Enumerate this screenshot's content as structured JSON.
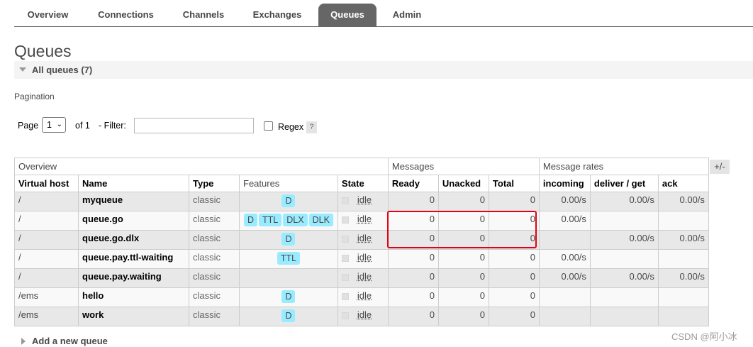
{
  "nav": {
    "tabs": [
      {
        "label": "Overview",
        "active": false
      },
      {
        "label": "Connections",
        "active": false
      },
      {
        "label": "Channels",
        "active": false
      },
      {
        "label": "Exchanges",
        "active": false
      },
      {
        "label": "Queues",
        "active": true
      },
      {
        "label": "Admin",
        "active": false
      }
    ]
  },
  "page": {
    "title": "Queues",
    "section_label": "All queues (7)"
  },
  "pagination": {
    "label": "Pagination",
    "page_label": "Page",
    "page_value": "1",
    "of_label": "of 1",
    "filter_label": "- Filter:",
    "filter_value": "",
    "regex_label": "Regex",
    "regex_checked": false,
    "help_label": "?"
  },
  "table": {
    "groups": {
      "overview": "Overview",
      "messages": "Messages",
      "rates": "Message rates"
    },
    "toggle_label": "+/-",
    "columns": {
      "vhost": "Virtual host",
      "name": "Name",
      "type": "Type",
      "features": "Features",
      "state": "State",
      "ready": "Ready",
      "unacked": "Unacked",
      "total": "Total",
      "incoming": "incoming",
      "deliver_get": "deliver / get",
      "ack": "ack"
    },
    "rows": [
      {
        "vhost": "/",
        "name": "myqueue",
        "type": "classic",
        "features": [
          "D"
        ],
        "state": "idle",
        "ready": "0",
        "unacked": "0",
        "total": "0",
        "incoming": "0.00/s",
        "deliver_get": "0.00/s",
        "ack": "0.00/s"
      },
      {
        "vhost": "/",
        "name": "queue.go",
        "type": "classic",
        "features": [
          "D",
          "TTL",
          "DLX",
          "DLK"
        ],
        "state": "idle",
        "ready": "0",
        "unacked": "0",
        "total": "0",
        "incoming": "0.00/s",
        "deliver_get": "",
        "ack": ""
      },
      {
        "vhost": "/",
        "name": "queue.go.dlx",
        "type": "classic",
        "features": [
          "D"
        ],
        "state": "idle",
        "ready": "0",
        "unacked": "0",
        "total": "0",
        "incoming": "",
        "deliver_get": "0.00/s",
        "ack": "0.00/s"
      },
      {
        "vhost": "/",
        "name": "queue.pay.ttl-waiting",
        "type": "classic",
        "features": [
          "TTL"
        ],
        "state": "idle",
        "ready": "0",
        "unacked": "0",
        "total": "0",
        "incoming": "0.00/s",
        "deliver_get": "",
        "ack": ""
      },
      {
        "vhost": "/",
        "name": "queue.pay.waiting",
        "type": "classic",
        "features": [],
        "state": "idle",
        "ready": "0",
        "unacked": "0",
        "total": "0",
        "incoming": "0.00/s",
        "deliver_get": "0.00/s",
        "ack": "0.00/s"
      },
      {
        "vhost": "/ems",
        "name": "hello",
        "type": "classic",
        "features": [
          "D"
        ],
        "state": "idle",
        "ready": "0",
        "unacked": "0",
        "total": "0",
        "incoming": "",
        "deliver_get": "",
        "ack": ""
      },
      {
        "vhost": "/ems",
        "name": "work",
        "type": "classic",
        "features": [
          "D"
        ],
        "state": "idle",
        "ready": "0",
        "unacked": "0",
        "total": "0",
        "incoming": "",
        "deliver_get": "",
        "ack": ""
      }
    ]
  },
  "add_queue": {
    "label": "Add a new queue"
  },
  "watermark": "CSDN @阿小冰",
  "colors": {
    "nav_active": "#666666",
    "feature_badge": "#99ebff",
    "highlight_box": "#e60012",
    "row_alt": "#e8e8e8"
  }
}
